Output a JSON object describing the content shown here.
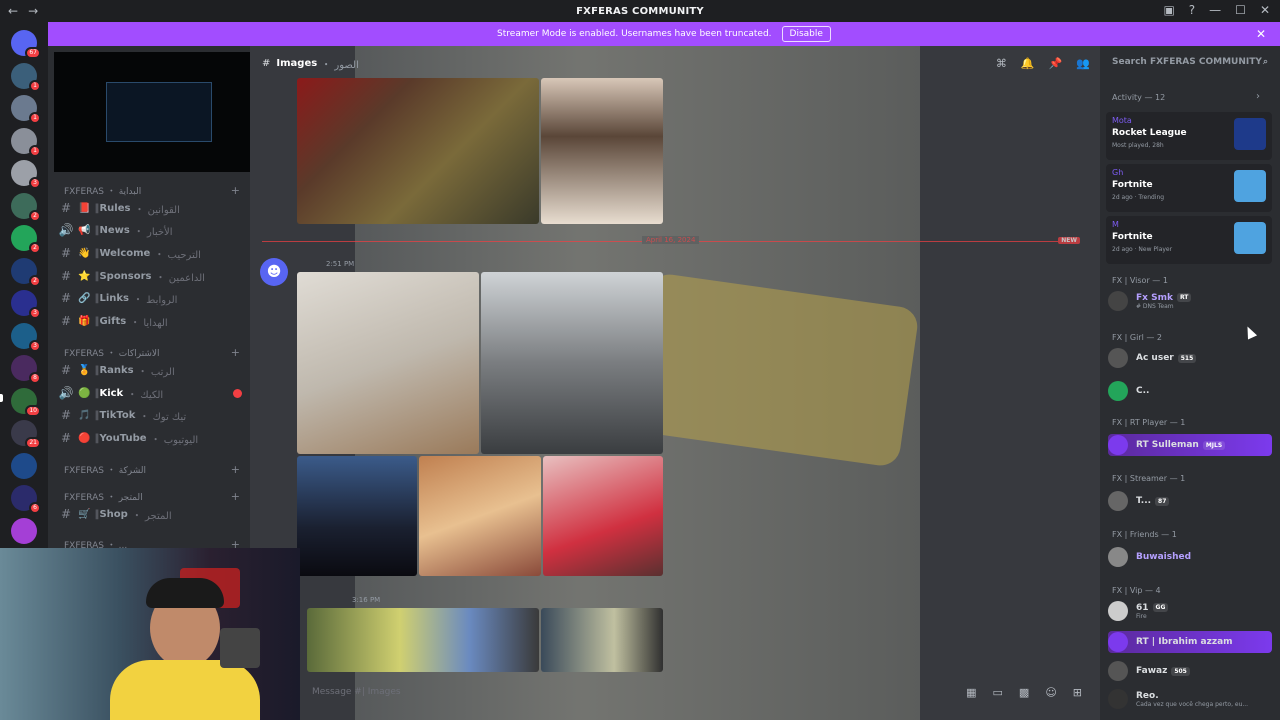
{
  "titlebar": {
    "title": "FXFERAS COMMUNITY"
  },
  "banner": {
    "text": "Streamer Mode is enabled. Usernames have been truncated.",
    "disable_label": "Disable"
  },
  "servers": [
    {
      "badge": "67",
      "color": "#5865f2"
    },
    {
      "badge": "1",
      "color": "#3b5f7a"
    },
    {
      "badge": "1",
      "color": "#6b7a8f"
    },
    {
      "badge": "1",
      "color": "#8a8f99"
    },
    {
      "badge": "3",
      "color": "#9ca0a8"
    },
    {
      "badge": "2",
      "color": "#3d6b5a"
    },
    {
      "badge": "2",
      "color": "#23a55a"
    },
    {
      "badge": "2",
      "color": "#1f3b73"
    },
    {
      "badge": "3",
      "color": "#2a2f8f"
    },
    {
      "badge": "3",
      "color": "#1c5f8a"
    },
    {
      "badge": "8",
      "color": "#4a2a5f"
    },
    {
      "badge": "10",
      "color": "#2f6b3a"
    },
    {
      "badge": "21",
      "color": "#3a3a4a"
    },
    {
      "badge": "",
      "color": "#1e4a8a"
    },
    {
      "badge": "6",
      "color": "#2b2b6b"
    },
    {
      "badge": "",
      "color": "#a43fd6"
    }
  ],
  "channels": {
    "categories": [
      {
        "label": "FXFERAS ・ البداية"
      },
      {
        "label": "FXFERAS ・ الاشتراكات"
      },
      {
        "label": "FXFERAS ・ الشركة"
      },
      {
        "label": "FXFERAS ・ المتجر"
      },
      {
        "label": "FXFERAS ・ ..."
      }
    ],
    "items": [
      {
        "icon": "📕",
        "name": "Rules",
        "arabic": "・ القوانين"
      },
      {
        "icon": "📢",
        "name": "News",
        "arabic": "・ الأخبار"
      },
      {
        "icon": "👋",
        "name": "Welcome",
        "arabic": "・ الترحيب"
      },
      {
        "icon": "⭐",
        "name": "Sponsors",
        "arabic": "・ الداعمين"
      },
      {
        "icon": "🔗",
        "name": "Links",
        "arabic": "・ الروابط"
      },
      {
        "icon": "🎁",
        "name": "Gifts",
        "arabic": "・ الهدايا"
      },
      {
        "icon": "🏅",
        "name": "Ranks",
        "arabic": "・ الرتب"
      },
      {
        "icon": "🟢",
        "name": "Kick",
        "arabic": "・ الكيك"
      },
      {
        "icon": "🎵",
        "name": "TikTok",
        "arabic": "・ تيك توك"
      },
      {
        "icon": "🔴",
        "name": "YouTube",
        "arabic": "・ اليوتيوب"
      },
      {
        "icon": "🛒",
        "name": "Shop",
        "arabic": "・ المتجر"
      }
    ]
  },
  "chat": {
    "channel_name": "Images",
    "channel_arabic": "・ الصور",
    "date_divider": "April 16, 2024",
    "new_label": "NEW",
    "time1": "2:51 PM",
    "time2": "3:16 PM",
    "composer_placeholder": "Message #| Images"
  },
  "members": {
    "search_placeholder": "Search FXFERAS COMMUNITY",
    "activity_header": "Activity — 12",
    "activities": [
      {
        "user": "Mota",
        "game": "Rocket League",
        "meta": "Most played, 28h",
        "color": "#1e3a8a"
      },
      {
        "user": "Gh",
        "game": "Fortnite",
        "meta": "2d ago  ·  Trending",
        "color": "#4fa3e0"
      },
      {
        "user": "M",
        "game": "Fortnite",
        "meta": "2d ago  ·  New Player",
        "color": "#4fa3e0"
      }
    ],
    "groups": [
      {
        "header": "FX | Visor — 1",
        "members": [
          {
            "name": "Fx Smk",
            "tag": "RT",
            "sub": "# DNS Team",
            "color": "#b5a0ff",
            "av": "#444"
          }
        ]
      },
      {
        "header": "FX | Girl — 2",
        "members": [
          {
            "name": "Ac user",
            "tag": "515",
            "sub": "",
            "color": "#dbdee1",
            "av": "#555"
          },
          {
            "name": "C..",
            "tag": "",
            "sub": "",
            "color": "#dbdee1",
            "av": "#23a55a"
          }
        ]
      },
      {
        "header": "FX | RT Player — 1",
        "members": [
          {
            "name": "RT Sulleman",
            "tag": "MJLS",
            "sub": "",
            "color": "#dbdee1",
            "av": "#7c3aed",
            "hl": true
          }
        ]
      },
      {
        "header": "FX | Streamer — 1",
        "members": [
          {
            "name": "T...",
            "tag": "87",
            "sub": "",
            "color": "#dbdee1",
            "av": "#666"
          }
        ]
      },
      {
        "header": "FX | Friends — 1",
        "members": [
          {
            "name": "Buwaished",
            "tag": "",
            "sub": "",
            "color": "#b5a0ff",
            "av": "#888"
          }
        ]
      },
      {
        "header": "FX | Vip — 4",
        "members": [
          {
            "name": "61",
            "tag": "GG",
            "sub": "Fire",
            "color": "#dbdee1",
            "av": "#ccc"
          },
          {
            "name": "RT | Ibrahim azzam",
            "tag": "",
            "sub": "",
            "color": "#dbdee1",
            "av": "#7c3aed",
            "hl": true
          },
          {
            "name": "Fawaz",
            "tag": "505",
            "sub": "",
            "color": "#dbdee1",
            "av": "#555"
          },
          {
            "name": "Reo.",
            "tag": "",
            "sub": "Cada vez que você chega perto, eu...",
            "color": "#dbdee1",
            "av": "#333"
          }
        ]
      }
    ]
  }
}
